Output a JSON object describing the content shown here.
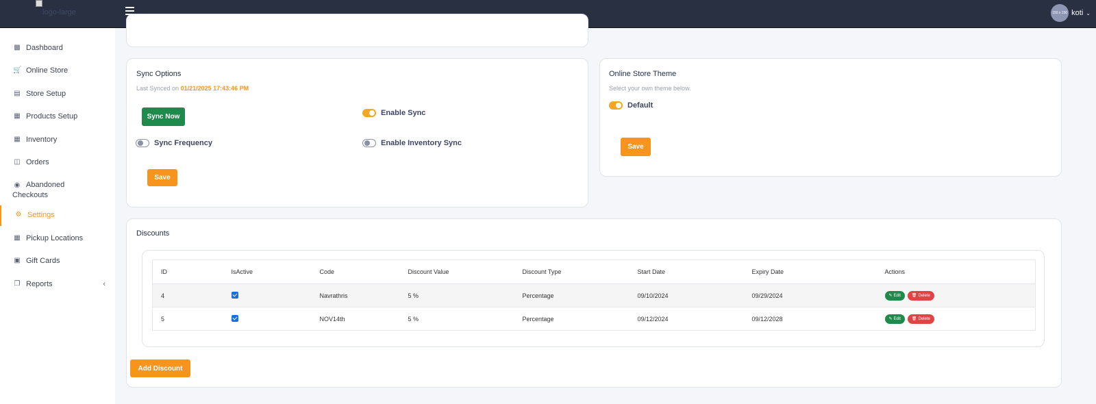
{
  "header": {
    "logo_alt": "logo-large",
    "avatar_text": "150 x 150",
    "user_name": "koti"
  },
  "sidebar": {
    "items": [
      {
        "label": "Dashboard",
        "icon": "bar-chart-icon"
      },
      {
        "label": "Online Store",
        "icon": "cart-icon"
      },
      {
        "label": "Store Setup",
        "icon": "store-icon"
      },
      {
        "label": "Products Setup",
        "icon": "grid-icon"
      },
      {
        "label": "Inventory",
        "icon": "grid-icon"
      },
      {
        "label": "Orders",
        "icon": "basket-icon"
      },
      {
        "label": "Abandoned Checkouts",
        "icon": "eye-icon"
      },
      {
        "label": "Settings",
        "icon": "gear-icon",
        "active": true
      },
      {
        "label": "Pickup Locations",
        "icon": "grid-icon"
      },
      {
        "label": "Gift Cards",
        "icon": "gift-icon"
      },
      {
        "label": "Reports",
        "icon": "copy-icon"
      }
    ]
  },
  "sync": {
    "title": "Sync Options",
    "last_synced_prefix": "Last Synced on",
    "last_synced_value": "01/21/2025 17:43:46 PM",
    "sync_now_label": "Sync Now",
    "enable_sync_label": "Enable Sync",
    "enable_sync_on": true,
    "sync_frequency_label": "Sync Frequency",
    "sync_frequency_on": false,
    "enable_inventory_sync_label": "Enable Inventory Sync",
    "enable_inventory_sync_on": false,
    "save_label": "Save"
  },
  "theme": {
    "title": "Online Store Theme",
    "subtitle": "Select your own theme below.",
    "default_label": "Default",
    "default_on": true,
    "save_label": "Save"
  },
  "discounts": {
    "title": "Discounts",
    "columns": [
      "ID",
      "IsActive",
      "Code",
      "Discount Value",
      "Discount Type",
      "Start Date",
      "Expiry Date",
      "Actions"
    ],
    "rows": [
      {
        "id": "4",
        "is_active": true,
        "code": "Navrathris",
        "value": "5 %",
        "type": "Percentage",
        "start": "09/10/2024",
        "expiry": "09/29/2024"
      },
      {
        "id": "5",
        "is_active": true,
        "code": "NOV14th",
        "value": "5 %",
        "type": "Percentage",
        "start": "09/12/2024",
        "expiry": "09/12/2028"
      }
    ],
    "edit_label": "Edit",
    "delete_label": "Delete",
    "add_label": "Add Discount"
  },
  "colors": {
    "accent": "#f7941d",
    "topbar": "#293042",
    "success": "#1e8a4c",
    "danger": "#e04545"
  }
}
